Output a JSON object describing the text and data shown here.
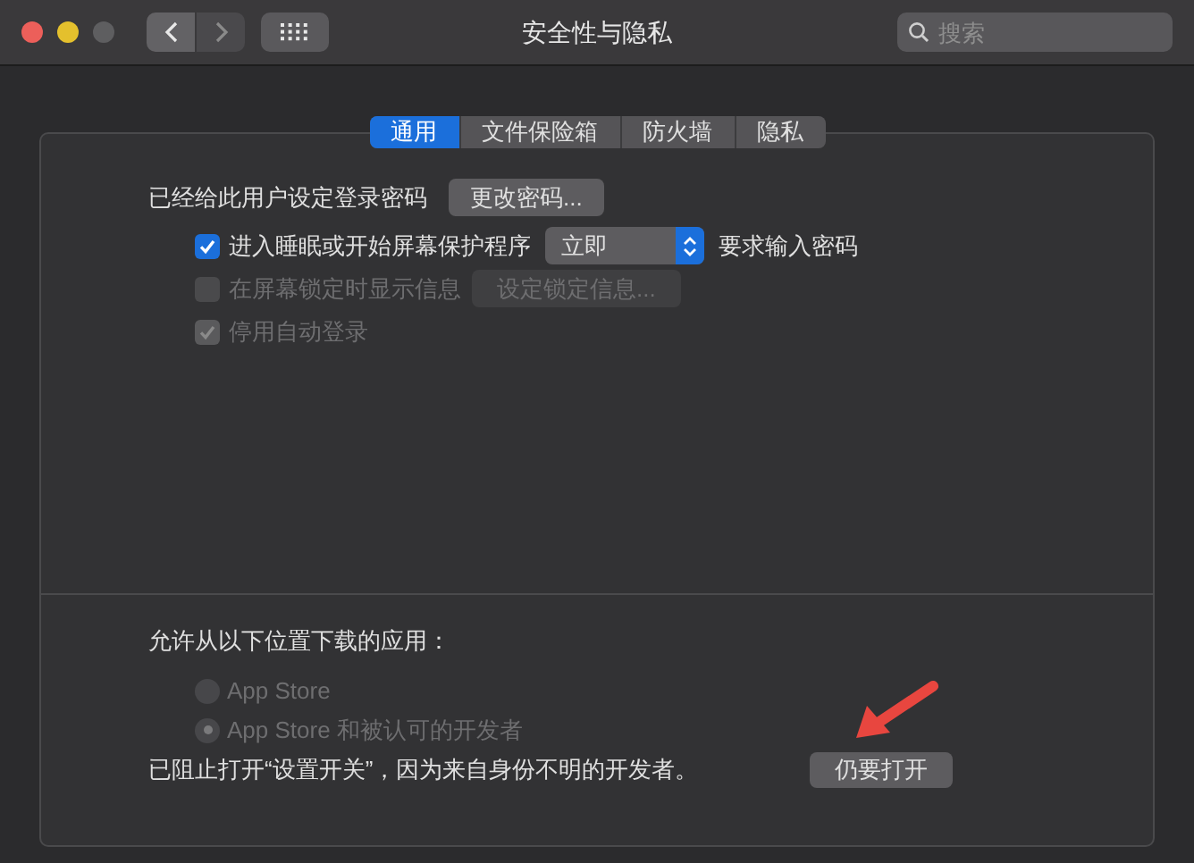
{
  "window": {
    "title": "安全性与隐私",
    "search": {
      "placeholder": "搜索"
    }
  },
  "tabs": [
    {
      "label": "通用",
      "selected": true
    },
    {
      "label": "文件保险箱",
      "selected": false
    },
    {
      "label": "防火墙",
      "selected": false
    },
    {
      "label": "隐私",
      "selected": false
    }
  ],
  "password": {
    "label": "已经给此用户设定登录密码",
    "button": "更改密码..."
  },
  "options": [
    {
      "kind": "select",
      "label": "进入睡眠或开始屏幕保护程序",
      "checked": true,
      "disabled": false,
      "value": "立即",
      "suffix": "要求输入密码"
    },
    {
      "kind": "button",
      "label": "在屏幕锁定时显示信息",
      "checked": false,
      "disabled": true,
      "button": "设定锁定信息..."
    },
    {
      "kind": "plain",
      "label": "停用自动登录",
      "checked": true,
      "disabled": true
    }
  ],
  "downloads": {
    "label": "允许从以下位置下载的应用：",
    "choices": [
      {
        "label": "App Store",
        "selected": false,
        "disabled": true
      },
      {
        "label": "App Store 和被认可的开发者",
        "selected": true,
        "disabled": true
      }
    ]
  },
  "blocked": {
    "message": "已阻止打开“设置开关”，因为来自身份不明的开发者。",
    "button": "仍要打开"
  }
}
